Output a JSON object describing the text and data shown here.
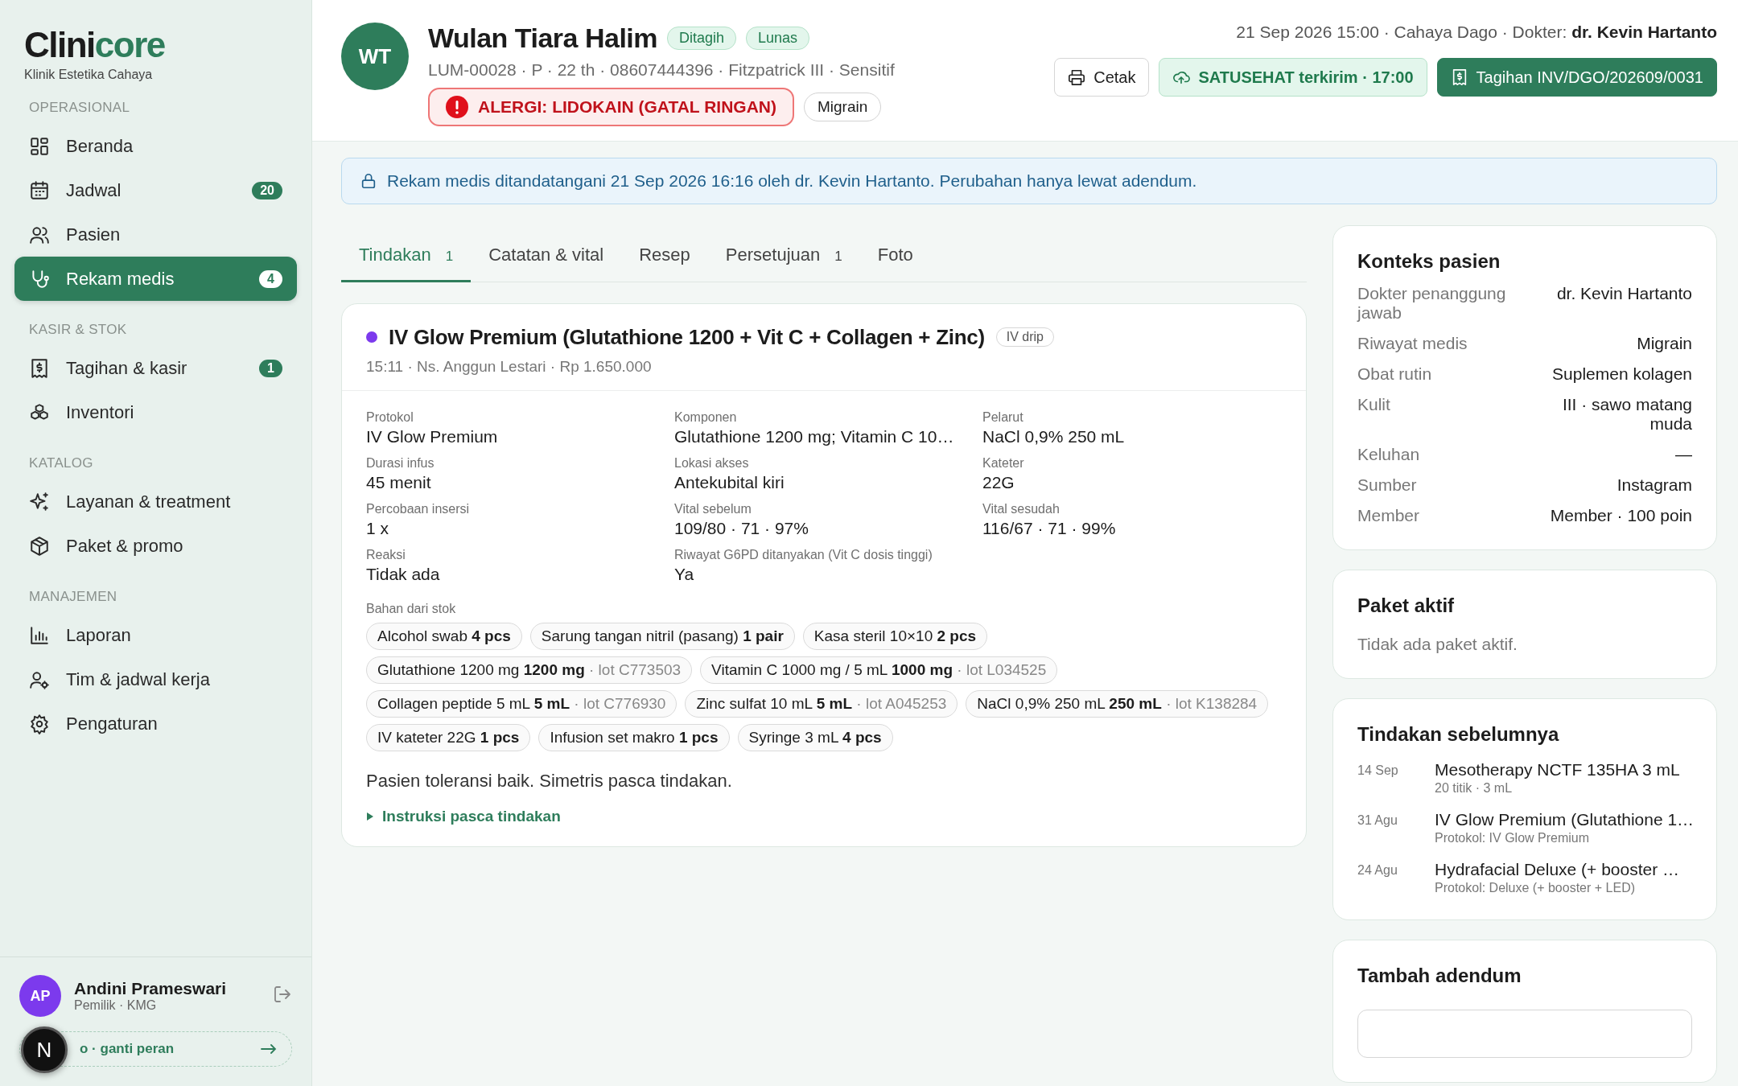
{
  "sidebar": {
    "logo": {
      "dark": "Clini",
      "accent": "core"
    },
    "clinic": "Klinik Estetika Cahaya",
    "sections": [
      {
        "title": "OPERASIONAL",
        "items": [
          {
            "kind": "grid",
            "label": "Beranda",
            "selected": false
          },
          {
            "kind": "calendar",
            "label": "Jadwal",
            "badge": "20",
            "selected": false
          },
          {
            "kind": "users",
            "label": "Pasien",
            "selected": false
          },
          {
            "kind": "stethoscope",
            "label": "Rekam medis",
            "badge": "4",
            "selected": true
          }
        ]
      },
      {
        "title": "KASIR & STOK",
        "items": [
          {
            "kind": "receipt",
            "label": "Tagihan & kasir",
            "badge": "1",
            "selected": false
          },
          {
            "kind": "boxes",
            "label": "Inventori",
            "selected": false
          }
        ]
      },
      {
        "title": "KATALOG",
        "items": [
          {
            "kind": "sparkles",
            "label": "Layanan & treatment",
            "selected": false
          },
          {
            "kind": "package",
            "label": "Paket & promo",
            "selected": false
          }
        ]
      },
      {
        "title": "MANAJEMEN",
        "items": [
          {
            "kind": "chart",
            "label": "Laporan",
            "selected": false
          },
          {
            "kind": "usergear",
            "label": "Tim & jadwal kerja",
            "selected": false
          },
          {
            "kind": "gear",
            "label": "Pengaturan",
            "selected": false
          }
        ]
      }
    ],
    "user": {
      "initials": "AP",
      "name": "Andini Prameswari",
      "role": "Pemilik · KMG"
    },
    "demo_link": "o · ganti peran",
    "dev_badge": "N"
  },
  "header": {
    "initials": "WT",
    "name": "Wulan Tiara Halim",
    "badges": [
      "Ditagih",
      "Lunas"
    ],
    "meta": "LUM-00028 · P · 22 th · 08607444396 · Fitzpatrick III · Sensitif",
    "allergy": "ALERGI: LIDOKAIN (GATAL RINGAN)",
    "conditions": [
      "Migrain"
    ],
    "visit": "21 Sep 2026 15:00 · Cahaya Dago · Dokter: **dr. Kevin Hartanto**",
    "buttons": [
      {
        "kind": "outline",
        "label": "Cetak"
      },
      {
        "kind": "soft",
        "label": "SATUSEHAT terkirim · 17:00"
      },
      {
        "kind": "primary",
        "label": "Tagihan INV/DGO/202609/0031"
      }
    ]
  },
  "notice": "Rekam medis ditandatangani 21 Sep 2026 16:16 oleh dr. Kevin Hartanto. Perubahan hanya lewat adendum.",
  "tabs": [
    {
      "label": "Tindakan",
      "count": "1",
      "selected": true
    },
    {
      "label": "Catatan & vital",
      "selected": false
    },
    {
      "label": "Resep",
      "selected": false
    },
    {
      "label": "Persetujuan",
      "count": "1",
      "selected": false
    },
    {
      "label": "Foto",
      "selected": false
    }
  ],
  "procedure": {
    "color": "#7c3aed",
    "title": "IV Glow Premium (Glutathione 1200 + Vit C + Collagen + Zinc)",
    "tag": "IV drip",
    "meta": "15:11 · Ns. Anggun Lestari · Rp 1.650.000",
    "fields": [
      {
        "label": "Protokol",
        "value": "IV Glow Premium"
      },
      {
        "label": "Komponen",
        "value": "Glutathione 1200 mg; Vitamin C 10…"
      },
      {
        "label": "Pelarut",
        "value": "NaCl 0,9% 250 mL"
      },
      {
        "label": "Durasi infus",
        "value": "45 menit"
      },
      {
        "label": "Lokasi akses",
        "value": "Antekubital kiri"
      },
      {
        "label": "Kateter",
        "value": "22G"
      },
      {
        "label": "Percobaan insersi",
        "value": "1 x"
      },
      {
        "label": "Vital sebelum",
        "value": "109/80 · 71 · 97%"
      },
      {
        "label": "Vital sesudah",
        "value": "116/67 · 71 · 99%"
      },
      {
        "label": "Reaksi",
        "value": "Tidak ada"
      },
      {
        "label": "Riwayat G6PD ditanyakan (Vit C dosis tinggi)",
        "value": "Ya"
      }
    ],
    "materials_label": "Bahan dari stok",
    "materials": [
      {
        "name": "Alcohol swab",
        "qty": "4 pcs"
      },
      {
        "name": "Sarung tangan nitril (pasang)",
        "qty": "1 pair"
      },
      {
        "name": "Kasa steril 10×10",
        "qty": "2 pcs"
      },
      {
        "name": "Glutathione 1200 mg",
        "qty": "1200 mg",
        "lot": "· lot C773503"
      },
      {
        "name": "Vitamin C 1000 mg / 5 mL",
        "qty": "1000 mg",
        "lot": "· lot L034525"
      },
      {
        "name": "Collagen peptide 5 mL",
        "qty": "5 mL",
        "lot": "· lot C776930"
      },
      {
        "name": "Zinc sulfat 10 mL",
        "qty": "5 mL",
        "lot": "· lot A045253"
      },
      {
        "name": "NaCl 0,9% 250 mL",
        "qty": "250 mL",
        "lot": "· lot K138284"
      },
      {
        "name": "IV kateter 22G",
        "qty": "1 pcs"
      },
      {
        "name": "Infusion set makro",
        "qty": "1 pcs"
      },
      {
        "name": "Syringe 3 mL",
        "qty": "4 pcs"
      }
    ],
    "note": "Pasien toleransi baik. Simetris pasca tindakan.",
    "disclosure": {
      "label": "Instruksi pasca tindakan",
      "expanded": false
    }
  },
  "context": {
    "title": "Konteks pasien",
    "rows": [
      {
        "label": "Dokter penanggung jawab",
        "value": "dr. Kevin Hartanto"
      },
      {
        "label": "Riwayat medis",
        "value": "Migrain"
      },
      {
        "label": "Obat rutin",
        "value": "Suplemen kolagen"
      },
      {
        "label": "Kulit",
        "value": "III · sawo matang muda"
      },
      {
        "label": "Keluhan",
        "value": "—"
      },
      {
        "label": "Sumber",
        "value": "Instagram"
      },
      {
        "label": "Member",
        "value": "Member · 100 poin"
      }
    ]
  },
  "package": {
    "title": "Paket aktif",
    "empty": "Tidak ada paket aktif."
  },
  "history": {
    "title": "Tindakan sebelumnya",
    "items": [
      {
        "date": "14 Sep",
        "title": "Mesotherapy NCTF 135HA 3 mL",
        "sub": "20 titik · 3 mL"
      },
      {
        "date": "31 Agu",
        "title": "IV Glow Premium (Glutathione 1…",
        "sub": "Protokol: IV Glow Premium"
      },
      {
        "date": "24 Agu",
        "title": "Hydrafacial Deluxe (+ booster …",
        "sub": "Protokol: Deluxe (+ booster + LED)"
      }
    ]
  },
  "addendum": {
    "title": "Tambah adendum"
  }
}
